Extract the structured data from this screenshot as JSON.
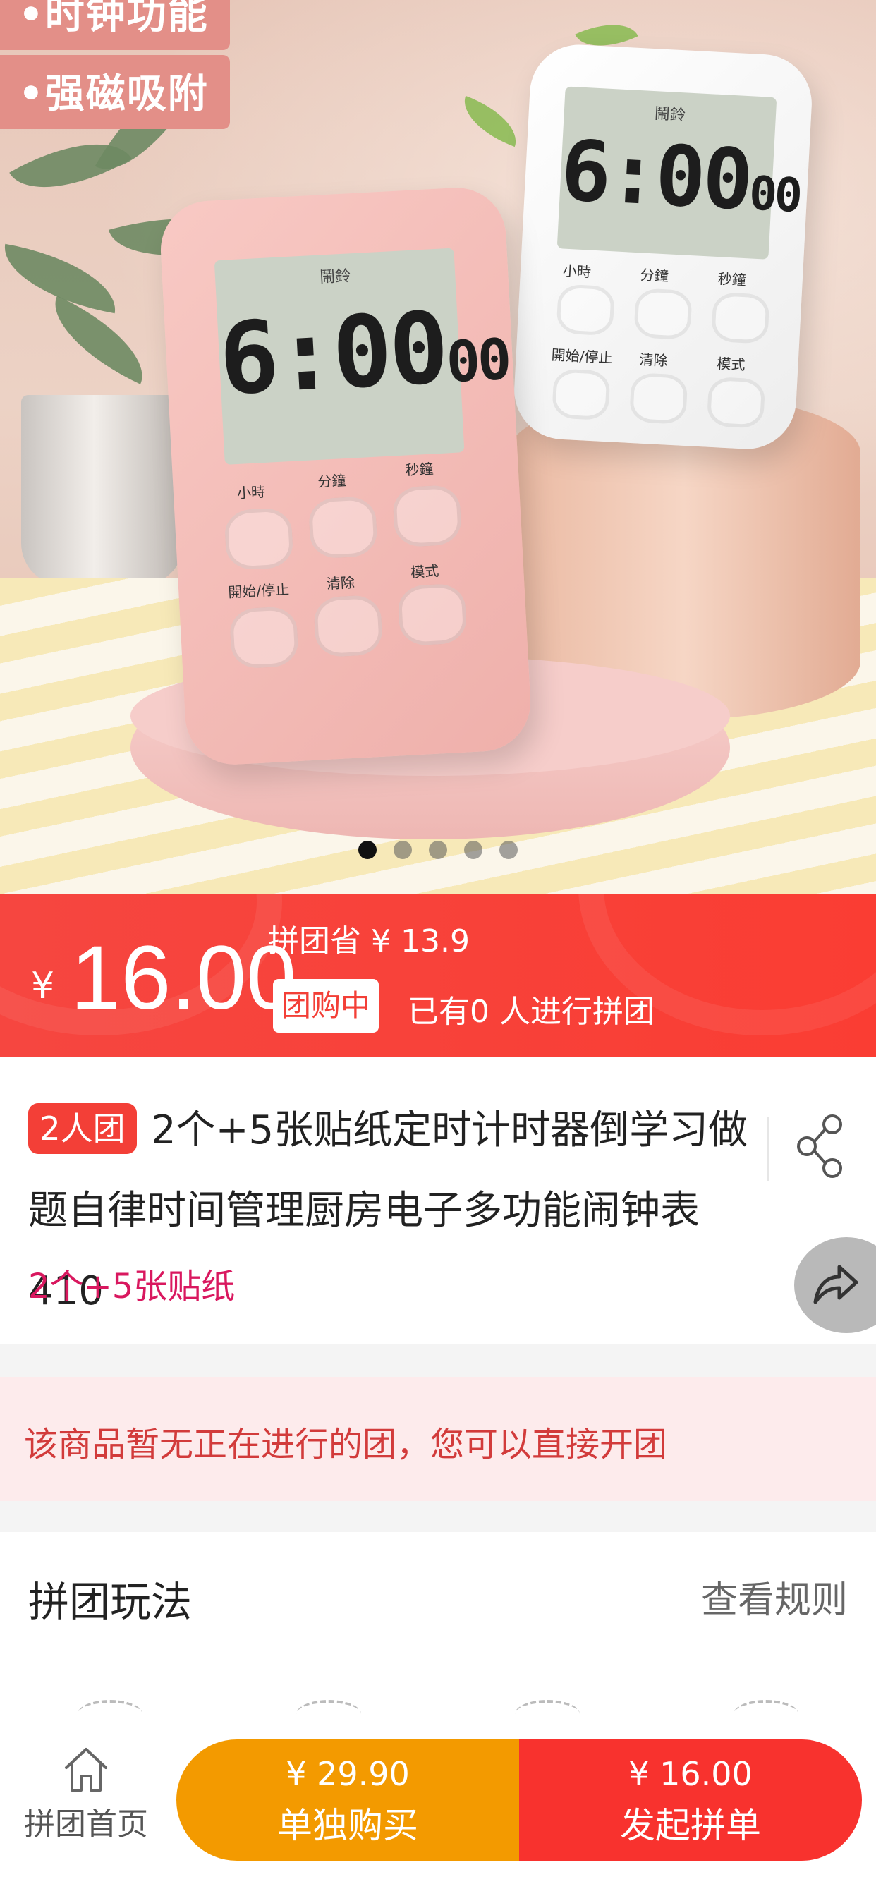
{
  "hero": {
    "tags": [
      "•时钟功能",
      "•强磁吸附"
    ],
    "device_brand": "鬧鈴",
    "device_time": "6:00",
    "device_seconds": "00",
    "device_buttons": [
      "小時",
      "分鐘",
      "秒鐘",
      "開始/停止",
      "清除",
      "模式"
    ],
    "carousel_count": 5,
    "carousel_active": 1
  },
  "price": {
    "currency": "¥",
    "amount": "16.00",
    "save_text": "拼团省 ¥ 13.9",
    "status_chip": "团购中",
    "joined_text": "已有0 人进行拼团"
  },
  "product": {
    "team_badge": "2人团",
    "title": "2个+5张贴纸定时计时器倒学习做题自律时间管理厨房电子多功能闹钟表 410",
    "spec": "2个+5张贴纸"
  },
  "notice": {
    "text": "该商品暂无正在进行的团，您可以直接开团"
  },
  "rules": {
    "heading": "拼团玩法",
    "link": "查看规则"
  },
  "bottom_bar": {
    "home_label": "拼团首页",
    "single_price": "¥ 29.90",
    "single_label": "单独购买",
    "group_price": "¥ 16.00",
    "group_label": "发起拼单",
    "colors": {
      "single": "#f39a00",
      "group": "#f8322e"
    }
  },
  "colors": {
    "accent_red": "#f33f37",
    "spec_pink": "#d9185f",
    "notice_text": "#d23b3b"
  }
}
